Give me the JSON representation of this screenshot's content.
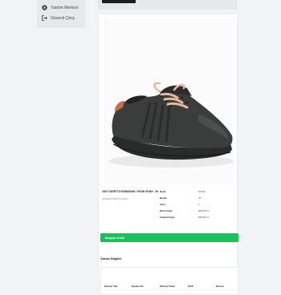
{
  "sidebar": {
    "items": [
      {
        "label": "Yardım Merkezi",
        "icon": "close-circle-icon"
      },
      {
        "label": "Güvenli Çıkış",
        "icon": "logout-icon"
      }
    ]
  },
  "product": {
    "name": "1100 CARETTA ROMANIAN / SİYAH SİYAH - 46",
    "code": "40000ACARETTA-0166"
  },
  "details": [
    {
      "label": "Renk",
      "value": "SİYAH"
    },
    {
      "label": "Beden",
      "value": "46"
    },
    {
      "label": "Adet",
      "value": "1"
    },
    {
      "label": "Birim Fiyat",
      "value": "969,00 TL"
    },
    {
      "label": "Toplam Fiyat",
      "value": "969,00 TL"
    }
  ],
  "status": {
    "text": "Kargoya Verildi",
    "color": "#16c35b"
  },
  "payment": {
    "title": "Ödeme Bilgileri",
    "columns": [
      "Ödeme Tipi",
      "Banka Adı",
      "Ödeme Tutarı",
      "Tarih",
      "Durum"
    ]
  },
  "colors": {
    "background": "#f2f3f5",
    "accent": "#16c35b"
  }
}
